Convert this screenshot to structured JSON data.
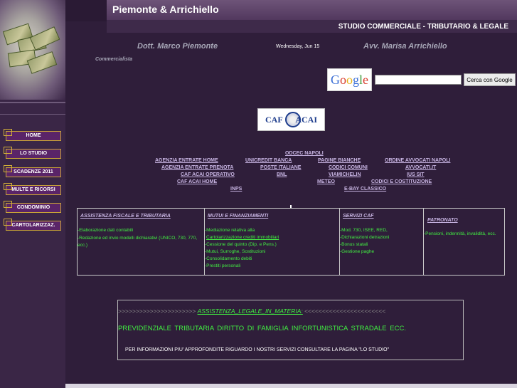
{
  "header": {
    "brand": "Piemonte & Arrichiello",
    "subtitle": "STUDIO COMMERCIALE - TRIBUTARIO & LEGALE"
  },
  "people": {
    "dott": "Dott. Marco Piemonte",
    "date": "Wednesday, Jun 15",
    "avv": "Avv. Marisa Arrichiello",
    "role": "Commercialista"
  },
  "search": {
    "logo": "Google",
    "value": "",
    "button": "Cerca con Google"
  },
  "caf_logo": {
    "left": "CAF",
    "right": "ACAI"
  },
  "nav": [
    {
      "label": "HOME"
    },
    {
      "label": "LO STUDIO"
    },
    {
      "label": "SCADENZE 2011"
    },
    {
      "label": "MULTE E RICORSI"
    },
    {
      "label": "CONDOMINIO"
    },
    {
      "label": "CARTOLARIZZAZ."
    }
  ],
  "links": {
    "odcec": "ODCEC NAPOLI",
    "agenzia_home": "AGENZIA ENTRATE HOME",
    "unicredit": "UNICREDIT BANCA",
    "pagine_bianche": "PAGINE BIANCHE",
    "ordine_avvocati": "ORDINE AVVOCATI NAPOLI",
    "agenzia_prenota": "AGENZIA ENTRATE PRENOTA",
    "poste": "POSTE ITALIANE",
    "codici_comuni": "CODICI COMUNI",
    "avvocati_it": "AVVOCATI.IT",
    "caf_operativo": "CAF ACAI OPERATIVO",
    "bnl": "BNL",
    "viamichelin": "VIAMICHELIN",
    "ius_sit": "IUS SIT",
    "caf_home": "CAF ACAI HOME",
    "meteo": "METEO",
    "codici_costituzione": "CODICI E COSTITUZIONE",
    "inps": "INPS",
    "ebay": "E-BAY CLASSICO"
  },
  "services": {
    "fiscale": {
      "title": "ASSISTENZA FISCALE E TRIBUTARIA",
      "items": [
        "-Elaborazione dati contabili",
        "-Redazione ed invio modelli dichiarativi (UNICO, 730, 770,",
        "ecc.)"
      ]
    },
    "mutui": {
      "title": "MUTUI E FINANZIAMENTI",
      "items": [
        "-Mediazione relativa alla",
        "Cartolarizzazione crediti immobiliari",
        "-Cessione del quinto (Dip. e Pens.)",
        "-Mutui, Surroghe, Sostituzioni",
        "-Consolidamento debiti",
        "-Prestiti personali"
      ]
    },
    "caf": {
      "title": "SERVIZI CAF",
      "items": [
        "-Mod. 730, ISEE, RED,",
        "-Dichiarazioni detrazioni",
        "-Bonus statali",
        "-Gestione paghe"
      ]
    },
    "patronato": {
      "title": "PATRONATO",
      "items": [
        "-Pensioni, indennità, invalidità, ecc."
      ]
    }
  },
  "legal": {
    "arrows_left": ">>>>>>>>>>>>>>>>>>>>>>",
    "title": "ASSISTENZA_LEGALE_IN_MATERIA:",
    "arrows_right": "<<<<<<<<<<<<<<<<<<<<<<<",
    "areas": "PREVIDENZIALE    TRIBUTARIA    DIRITTO  DI  FAMIGLIA    INFORTUNISTICA  STRADALE    ECC.",
    "info": "PER INFORMAZIONI PIU' APPROFONDITE RIGUARDO I NOSTRI SERVIZI CONSULTARE LA PAGINA \"LO STUDIO\""
  },
  "colors": {
    "background": "#2f1e3a",
    "link": "#c7b4e2",
    "green_text": "#41ee41",
    "nav_button": "#5a2468",
    "nav_border": "#c9a436"
  }
}
